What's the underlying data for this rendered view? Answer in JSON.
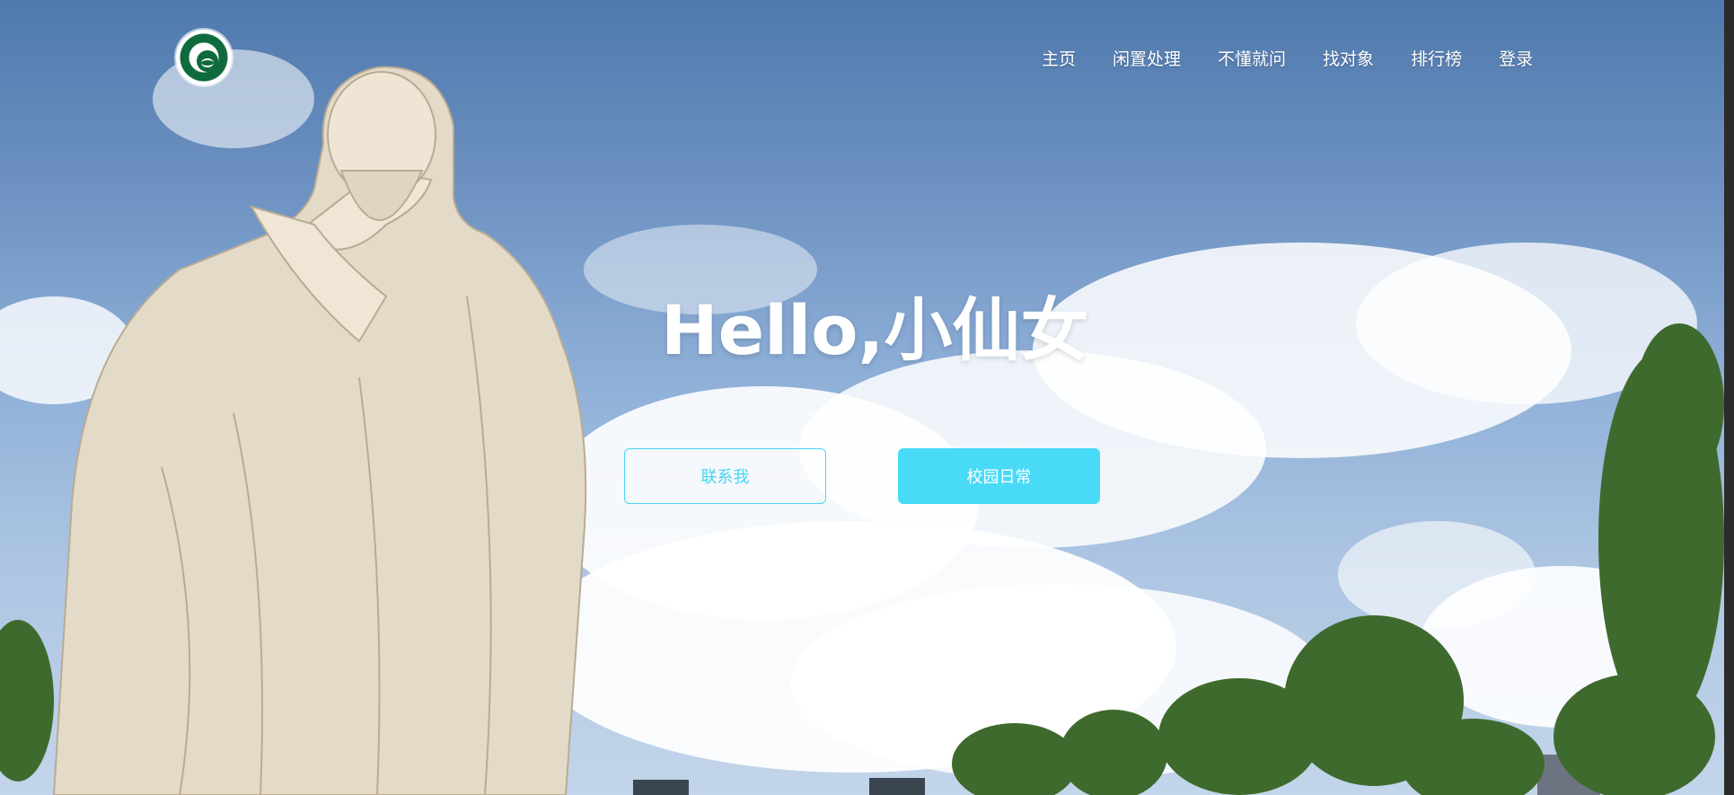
{
  "header": {
    "logo": "university-logo-emblem",
    "nav": [
      {
        "label": "主页"
      },
      {
        "label": "闲置处理"
      },
      {
        "label": "不懂就问"
      },
      {
        "label": "找对象"
      },
      {
        "label": "排行榜"
      },
      {
        "label": "登录"
      }
    ]
  },
  "hero": {
    "headline": "Hello,小仙女",
    "buttons": {
      "contact": "联系我",
      "campus_daily": "校园日常"
    }
  },
  "colors": {
    "accent": "#48daf7",
    "sky_top": "#4f79ad",
    "sky_bottom": "#c3d5ea",
    "statue": "#e6dccb",
    "trees": "#3f6a2e"
  }
}
